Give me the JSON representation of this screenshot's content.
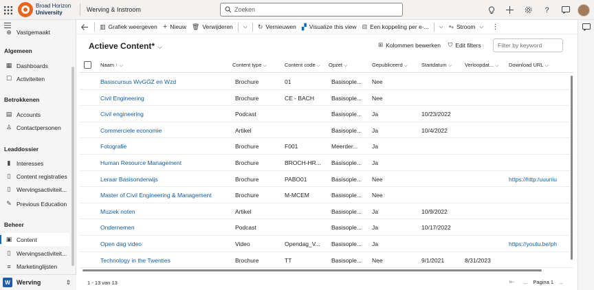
{
  "brand": {
    "line1": "Broad Horizon",
    "line2": "University"
  },
  "app_title": "Werving & Instroom",
  "search": {
    "placeholder": "Zoeken"
  },
  "nav": {
    "top_item": "Vastgemaakt",
    "groups": [
      {
        "label": "Algemeen",
        "items": [
          {
            "label": "Dashboards",
            "icon": "dashboard-icon"
          },
          {
            "label": "Activiteiten",
            "icon": "activity-icon"
          }
        ]
      },
      {
        "label": "Betrokkenen",
        "items": [
          {
            "label": "Accounts",
            "icon": "building-icon"
          },
          {
            "label": "Contactpersonen",
            "icon": "person-icon"
          }
        ]
      },
      {
        "label": "Leaddossier",
        "items": [
          {
            "label": "Interesses",
            "icon": "interest-icon"
          },
          {
            "label": "Content registraties",
            "icon": "document-icon"
          },
          {
            "label": "Wervingsactiviteit...",
            "icon": "document-icon"
          },
          {
            "label": "Previous Education",
            "icon": "education-icon"
          }
        ]
      },
      {
        "label": "Beheer",
        "items": [
          {
            "label": "Content",
            "icon": "content-icon"
          },
          {
            "label": "Wervingsactiviteit...",
            "icon": "document-icon"
          },
          {
            "label": "Marketinglijsten",
            "icon": "list-icon"
          }
        ]
      }
    ],
    "area": {
      "badge": "W",
      "name": "Werving"
    }
  },
  "commands": {
    "chart": "Grafiek weergeven",
    "new": "Nieuw",
    "delete": "Verwijderen",
    "refresh": "Vernieuwen",
    "visualize": "Visualize this view",
    "share": "Een koppeling per e-...",
    "flow": "Stroom"
  },
  "view": {
    "title": "Actieve Content*",
    "edit_columns": "Kolommen bewerken",
    "edit_filters": "Edit filters",
    "filter_placeholder": "Filter by keyword"
  },
  "columns": [
    "Naam",
    "Content type",
    "Content code",
    "Opzet",
    "Gepubliceerd",
    "Startdatum",
    "Verloopdat...",
    "Download URL"
  ],
  "rows": [
    {
      "naam": "Basiscursus WvGGZ en Wzd",
      "type": "Brochure",
      "code": "01",
      "opzet": "Basisople...",
      "pub": "Nee",
      "start": "",
      "end": "",
      "url": ""
    },
    {
      "naam": "Civil Engineering",
      "type": "Brochure",
      "code": "CE - BACH",
      "opzet": "Basisople...",
      "pub": "Nee",
      "start": "",
      "end": "",
      "url": ""
    },
    {
      "naam": "Civil engineering",
      "type": "Podcast",
      "code": "",
      "opzet": "Basisople...",
      "pub": "Ja",
      "start": "10/23/2022",
      "end": "",
      "url": ""
    },
    {
      "naam": "Commerciele economie",
      "type": "Artikel",
      "code": "",
      "opzet": "Basisople...",
      "pub": "Ja",
      "start": "10/4/2022",
      "end": "",
      "url": ""
    },
    {
      "naam": "Fotografie",
      "type": "Brochure",
      "code": "F001",
      "opzet": "Meerder...",
      "pub": "Ja",
      "start": "",
      "end": "",
      "url": ""
    },
    {
      "naam": "Human Resource Management",
      "type": "Brochure",
      "code": "BROCH-HR...",
      "opzet": "Basisople...",
      "pub": "Ja",
      "start": "",
      "end": "",
      "url": ""
    },
    {
      "naam": "Leraar Basisonderwijs",
      "type": "Brochure",
      "code": "PABO01",
      "opzet": "Basisople...",
      "pub": "Nee",
      "start": "",
      "end": "",
      "url": "https://http:/uuuriiu"
    },
    {
      "naam": "Master of Civil Engineering & Management",
      "type": "Brochure",
      "code": "M-MCEM",
      "opzet": "Basisople...",
      "pub": "Nee",
      "start": "",
      "end": "",
      "url": ""
    },
    {
      "naam": "Muziek noten",
      "type": "Artikel",
      "code": "",
      "opzet": "Basisople...",
      "pub": "Ja",
      "start": "10/9/2022",
      "end": "",
      "url": ""
    },
    {
      "naam": "Ondernemen",
      "type": "Podcast",
      "code": "",
      "opzet": "Basisople...",
      "pub": "Ja",
      "start": "10/17/2022",
      "end": "",
      "url": ""
    },
    {
      "naam": "Open dag video",
      "type": "Video",
      "code": "Opendag_V...",
      "opzet": "Basisople...",
      "pub": "Ja",
      "start": "",
      "end": "",
      "url": "https://youtu.be/ph"
    },
    {
      "naam": "Technology in the Twenties",
      "type": "Brochure",
      "code": "TT",
      "opzet": "Basisople...",
      "pub": "Nee",
      "start": "9/1/2021",
      "end": "8/31/2023",
      "url": ""
    }
  ],
  "footer": {
    "count": "1 - 13 van 13",
    "page": "Pagina 1"
  }
}
